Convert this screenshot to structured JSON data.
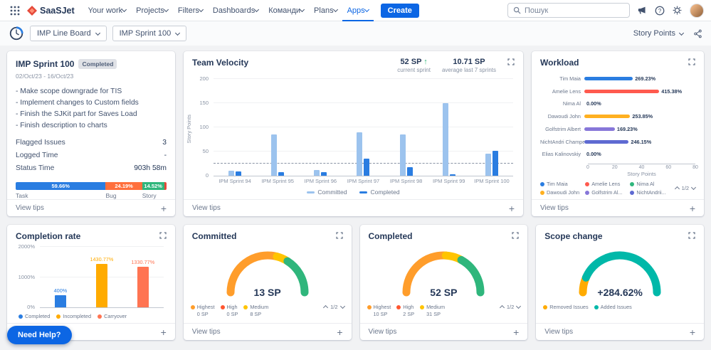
{
  "nav": {
    "brand": "SaaSJet",
    "menu": [
      "Your work",
      "Projects",
      "Filters",
      "Dashboards",
      "Команди",
      "Plans",
      "Apps"
    ],
    "active_item": "Apps",
    "create_label": "Create",
    "search_placeholder": "Пошук"
  },
  "toolbar": {
    "board": "IMP Line Board",
    "sprint": "IMP Sprint 100",
    "metric": "Story Points"
  },
  "common": {
    "view_tips": "View tips",
    "need_help": "Need Help?"
  },
  "sprint_card": {
    "title": "IMP Sprint 100",
    "badge": "Completed",
    "dates": "02/Oct/23 - 16/Oct/23",
    "goals": [
      "- Make scope downgrade for TIS",
      "- Implement changes to Custom fields",
      "- Finish the SJKit part for Saves Load",
      "- Finish description to charts"
    ],
    "stats": [
      {
        "label": "Flagged Issues",
        "value": "3"
      },
      {
        "label": "Logged Time",
        "value": "-"
      },
      {
        "label": "Status Time",
        "value": "903h 58m"
      }
    ],
    "issue_bar": [
      {
        "label": "Task",
        "pct": 59.66,
        "text": "59.66%",
        "color": "#2a7de1"
      },
      {
        "label": "Bug",
        "pct": 24.19,
        "text": "24.19%",
        "color": "#ff6f3c"
      },
      {
        "label": "Story",
        "pct": 14.52,
        "text": "14.52%",
        "color": "#2fb67c"
      },
      {
        "label": "",
        "pct": 1.63,
        "text": "",
        "color": "#e5493a"
      }
    ]
  },
  "velocity": {
    "title": "Team Velocity",
    "current_value": "52 SP",
    "current_arrow": "↑",
    "current_label": "current sprint",
    "avg_value": "10.71 SP",
    "avg_label": "average last 7 sprints",
    "ylabel": "Story Points",
    "ymax": 200,
    "yticks": [
      0,
      50,
      100,
      150,
      200
    ],
    "avg_line": 25,
    "categories": [
      "IPM Sprint 94",
      "IPM Sprint 95",
      "IPM Sprint 96",
      "IPM Sprint 97",
      "IPM Sprint 98",
      "IPM Sprint 99",
      "IPM Sprint 100"
    ],
    "series": [
      {
        "name": "Committed",
        "color": "#9cc3ee",
        "values": [
          10,
          85,
          12,
          90,
          85,
          150,
          45
        ]
      },
      {
        "name": "Completed",
        "color": "#2a7de1",
        "values": [
          9,
          8,
          8,
          35,
          18,
          3,
          52
        ]
      }
    ]
  },
  "workload": {
    "title": "Workload",
    "xlabel": "Story Points",
    "xticks": [
      "0",
      "20",
      "40",
      "60",
      "80"
    ],
    "xmax": 80,
    "rows": [
      {
        "name": "Tim Maia",
        "pct": "269.23%",
        "value": 35,
        "color": "#2a7de1"
      },
      {
        "name": "Amelie Lens",
        "pct": "415.38%",
        "value": 54,
        "color": "#ff5a4e"
      },
      {
        "name": "Nima Al",
        "pct": "0.00%",
        "value": 0,
        "color": "#2fb67c"
      },
      {
        "name": "Dawoudi John",
        "pct": "253.85%",
        "value": 33,
        "color": "#ffb020"
      },
      {
        "name": "Golfstrim Albert",
        "pct": "169.23%",
        "value": 22,
        "color": "#8777d9"
      },
      {
        "name": "NichtAndri Champel",
        "pct": "246.15%",
        "value": 32,
        "color": "#5e6ad2"
      },
      {
        "name": "Elias Kalinovskiy",
        "pct": "0.00%",
        "value": 0,
        "color": "#00b8d9"
      }
    ],
    "legend": [
      {
        "label": "Tim Maia",
        "color": "#2a7de1"
      },
      {
        "label": "Amelie Lens",
        "color": "#ff5a4e"
      },
      {
        "label": "Nima Al",
        "color": "#2fb67c"
      },
      {
        "label": "Dawoudi John",
        "color": "#ffb020"
      },
      {
        "label": "Golfstrim Al...",
        "color": "#8777d9"
      },
      {
        "label": "NichtAndrii...",
        "color": "#5e6ad2"
      }
    ],
    "pagination": "1/2"
  },
  "completion": {
    "title": "Completion rate",
    "yticks": [
      "0%",
      "1000%",
      "2000%"
    ],
    "ymax": 2000,
    "bars": [
      {
        "label": "Completed",
        "value": 400,
        "text": "400%",
        "color": "#2a7de1"
      },
      {
        "label": "Incompleted",
        "value": 1430.77,
        "text": "1430.77%",
        "color": "#ffab00"
      },
      {
        "label": "Carryover",
        "value": 1330.77,
        "text": "1330.77%",
        "color": "#ff7452"
      }
    ]
  },
  "committed": {
    "title": "Committed",
    "value": "13 SP",
    "segments": [
      {
        "color": "#ff9d2b",
        "pct": 58
      },
      {
        "color": "#ffc400",
        "pct": 10
      },
      {
        "color": "#2fb67c",
        "pct": 32
      }
    ],
    "legend": [
      {
        "label": "Highest",
        "value": "0 SP",
        "color": "#ff9d2b"
      },
      {
        "label": "High",
        "value": "0 SP",
        "color": "#ff5630"
      },
      {
        "label": "Medium",
        "value": "8 SP",
        "color": "#ffc400"
      }
    ],
    "pagination": "1/2"
  },
  "completed": {
    "title": "Completed",
    "value": "52 SP",
    "segments": [
      {
        "color": "#ff9d2b",
        "pct": 52
      },
      {
        "color": "#ffc400",
        "pct": 14
      },
      {
        "color": "#2fb67c",
        "pct": 34
      }
    ],
    "legend": [
      {
        "label": "Highest",
        "value": "10 SP",
        "color": "#ff9d2b"
      },
      {
        "label": "High",
        "value": "2 SP",
        "color": "#ff5630"
      },
      {
        "label": "Medium",
        "value": "31 SP",
        "color": "#ffc400"
      }
    ],
    "pagination": "1/2"
  },
  "scope_change": {
    "title": "Scope change",
    "value": "+284.62%",
    "segments": [
      {
        "color": "#ffab00",
        "pct": 13
      },
      {
        "color": "#00b8a9",
        "pct": 87
      }
    ],
    "legend": [
      {
        "label": "Removed Issues",
        "color": "#ffab00"
      },
      {
        "label": "Added Issues",
        "color": "#00b8a9"
      }
    ]
  }
}
